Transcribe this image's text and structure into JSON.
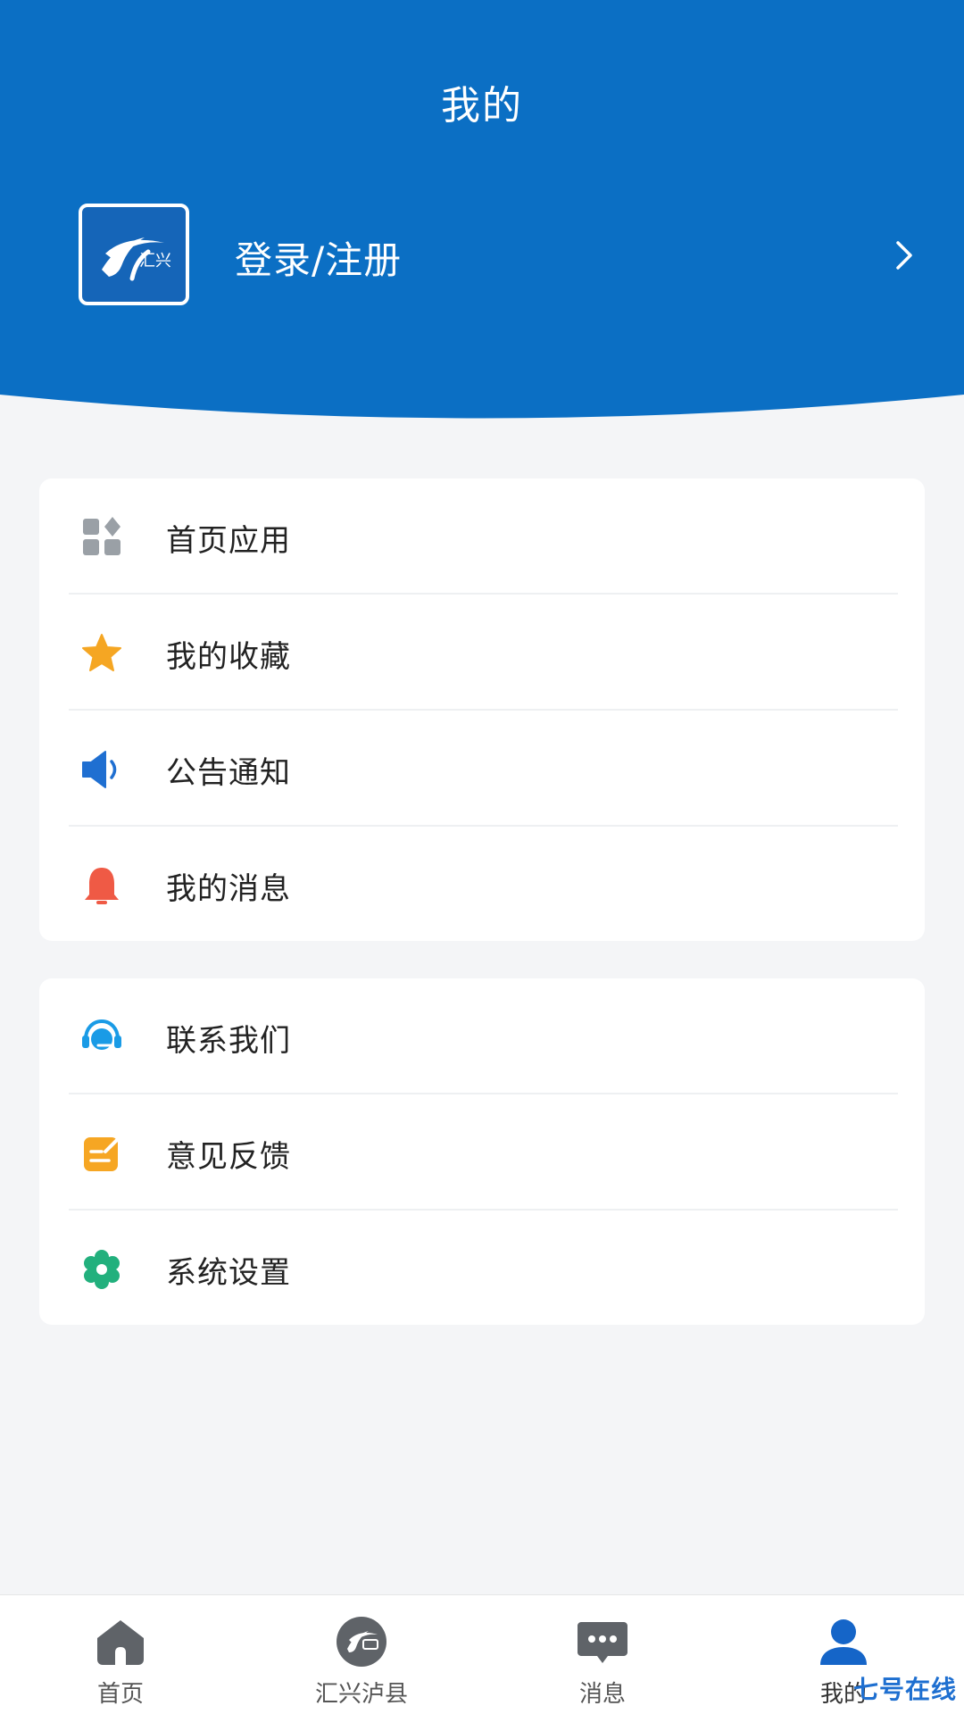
{
  "header": {
    "title": "我的",
    "login_label": "登录/注册",
    "logo_text": "汇兴",
    "brand_color": "#0b6fc4"
  },
  "menu_group_1": {
    "items": [
      {
        "label": "首页应用",
        "icon": "app-grid-icon",
        "color": "#9aa0a6"
      },
      {
        "label": "我的收藏",
        "icon": "star-icon",
        "color": "#f5a623"
      },
      {
        "label": "公告通知",
        "icon": "speaker-icon",
        "color": "#1f6fd1"
      },
      {
        "label": "我的消息",
        "icon": "bell-icon",
        "color": "#ef5a45"
      }
    ]
  },
  "menu_group_2": {
    "items": [
      {
        "label": "联系我们",
        "icon": "headset-icon",
        "color": "#1a9be6"
      },
      {
        "label": "意见反馈",
        "icon": "feedback-icon",
        "color": "#f6a623"
      },
      {
        "label": "系统设置",
        "icon": "gear-icon",
        "color": "#22b07d"
      }
    ]
  },
  "bottom_nav": {
    "items": [
      {
        "label": "首页",
        "icon": "home-icon"
      },
      {
        "label": "汇兴泸县",
        "icon": "logo-icon"
      },
      {
        "label": "消息",
        "icon": "chat-icon"
      },
      {
        "label": "我的",
        "icon": "user-icon",
        "active": true
      }
    ]
  },
  "watermark": "七号在线"
}
